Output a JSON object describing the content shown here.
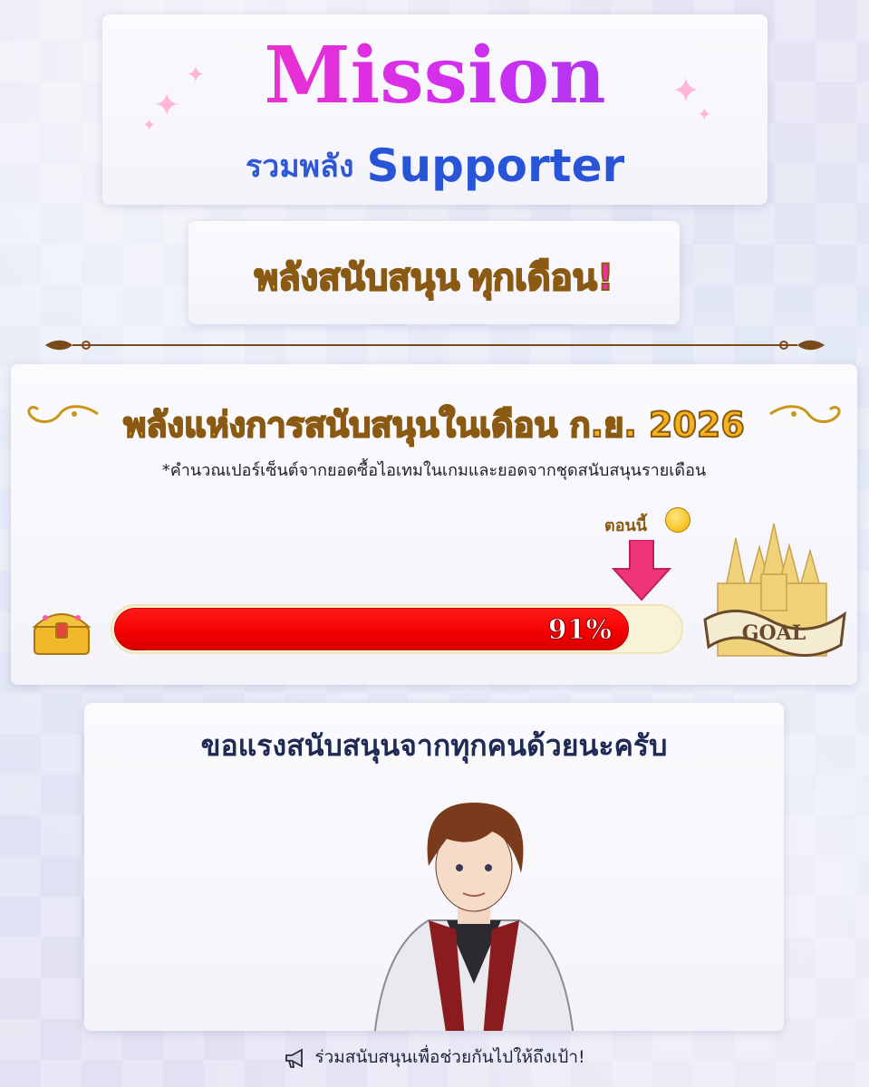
{
  "header": {
    "title": "Mission",
    "subtitle_th": "รวมพลัง",
    "subtitle_en": "Supporter"
  },
  "monthly_banner": {
    "text_a": "พลังสนับสนุน",
    "text_b": "ทุกเดือน!"
  },
  "progress": {
    "title": "พลังแห่งการสนับสนุนในเดือน ก.ย. 2026",
    "note": "*คำนวณเปอร์เซ็นต์จากยอดซื้อไอเทมในเกมและยอดจากชุดสนับสนุนรายเดือน",
    "now_label": "ตอนนี้",
    "percent_text": "91%",
    "percent_value": 91,
    "goal_label": "GOAL",
    "bar_color": "#f20000",
    "arrow_color": "#f0347a"
  },
  "message": {
    "text": "ขอแรงสนับสนุนจากทุกคนด้วยนะครับ"
  },
  "footer": {
    "text": "ร่วมสนับสนุนเพื่อช่วยกันไปให้ถึงเป้า!",
    "icon": "megaphone-icon"
  }
}
